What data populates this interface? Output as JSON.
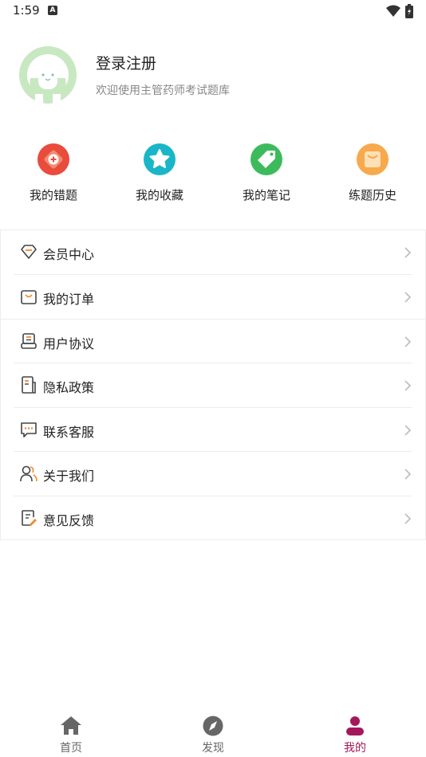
{
  "status_bar": {
    "time": "1:59",
    "a_badge": "A"
  },
  "profile": {
    "title": "登录注册",
    "subtitle": "欢迎使用主管药师考试题库"
  },
  "shortcuts": [
    {
      "label": "我的错题",
      "icon": "wrong-questions-icon",
      "color": "#e94b3c"
    },
    {
      "label": "我的收藏",
      "icon": "favorites-star-icon",
      "color": "#19b6c8"
    },
    {
      "label": "我的笔记",
      "icon": "notes-tag-icon",
      "color": "#3dbb5c"
    },
    {
      "label": "练题历史",
      "icon": "practice-history-bag-icon",
      "color": "#f7a94b"
    }
  ],
  "menu": [
    {
      "label": "会员中心",
      "icon": "diamond-icon"
    },
    {
      "label": "我的订单",
      "icon": "shopping-bag-icon"
    },
    {
      "label": "用户协议",
      "icon": "agreement-icon"
    },
    {
      "label": "隐私政策",
      "icon": "privacy-book-icon"
    },
    {
      "label": "联系客服",
      "icon": "chat-bubble-icon"
    },
    {
      "label": "关于我们",
      "icon": "people-icon"
    },
    {
      "label": "意见反馈",
      "icon": "feedback-edit-icon"
    }
  ],
  "tabbar": [
    {
      "label": "首页",
      "icon": "home-icon",
      "active": false
    },
    {
      "label": "发现",
      "icon": "compass-icon",
      "active": false
    },
    {
      "label": "我的",
      "icon": "profile-icon",
      "active": true
    }
  ],
  "colors": {
    "accent": "#a3185b",
    "icon_gray": "#666666",
    "accent_orange": "#f08a30"
  }
}
